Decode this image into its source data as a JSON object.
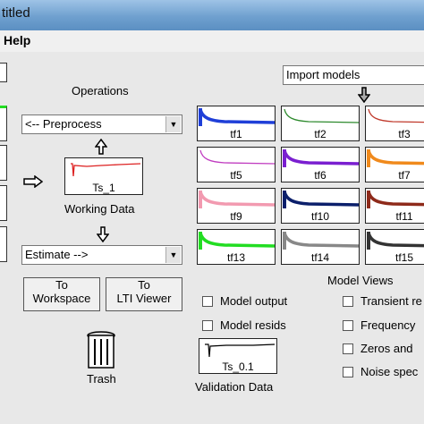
{
  "window": {
    "title": "titled"
  },
  "menu": {
    "help": "Help"
  },
  "operations": {
    "heading": "Operations",
    "preprocess": "<-- Preprocess",
    "estimate": "Estimate -->",
    "working_data_tile": "Ts_1",
    "working_data_label": "Working Data"
  },
  "buttons": {
    "to_workspace": [
      "To",
      "Workspace"
    ],
    "to_lti_viewer": [
      "To",
      "LTI Viewer"
    ]
  },
  "trash": {
    "label": "Trash"
  },
  "validation": {
    "tile": "Ts_0.1",
    "label": "Validation Data"
  },
  "import": {
    "dropdown": "Import models"
  },
  "models": [
    {
      "name": "tf1",
      "color": "#1f3fd8",
      "active": true
    },
    {
      "name": "tf2",
      "color": "#2d8a2d",
      "active": false
    },
    {
      "name": "tf3",
      "color": "#c0392b",
      "active": false
    },
    {
      "name": "tf5",
      "color": "#c03cc0",
      "active": false
    },
    {
      "name": "tf6",
      "color": "#7a1fd0",
      "active": true
    },
    {
      "name": "tf7",
      "color": "#f08a1c",
      "active": true
    },
    {
      "name": "tf9",
      "color": "#f29ab0",
      "active": true
    },
    {
      "name": "tf10",
      "color": "#0b1f6b",
      "active": true
    },
    {
      "name": "tf11",
      "color": "#8e2a1a",
      "active": true
    },
    {
      "name": "tf13",
      "color": "#22dd22",
      "active": true
    },
    {
      "name": "tf14",
      "color": "#888888",
      "active": true
    },
    {
      "name": "tf15",
      "color": "#333333",
      "active": true
    }
  ],
  "model_views": {
    "heading": "Model Views",
    "left": [
      "Model output",
      "Model resids"
    ],
    "right": [
      "Transient re",
      "Frequency",
      "Zeros and",
      "Noise spec"
    ]
  }
}
